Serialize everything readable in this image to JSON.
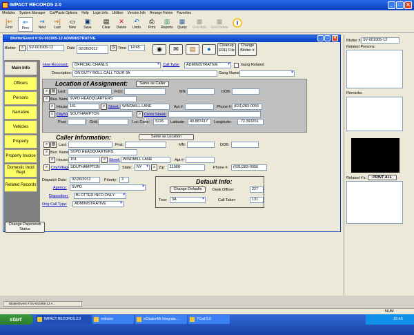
{
  "window": {
    "title": "IMPACT RECORDS 2.0"
  },
  "menu": [
    "Modules",
    "System Manager",
    "Cut/Paste Options",
    "Help",
    "Login Info",
    "Utilities",
    "Version Info",
    "Arrange Forms",
    "Favorites"
  ],
  "toolbar": [
    {
      "label": "First",
      "icon": "first-icon",
      "glyph": "|⇐"
    },
    {
      "label": "Prev",
      "icon": "prev-icon",
      "glyph": "⇐"
    },
    {
      "label": "Next",
      "icon": "next-icon",
      "glyph": "⇒"
    },
    {
      "label": "Last",
      "icon": "last-icon",
      "glyph": "⇒|"
    },
    {
      "label": "New",
      "icon": "new-icon",
      "glyph": "▭"
    },
    {
      "label": "Save",
      "icon": "save-icon",
      "glyph": "▣"
    },
    {
      "label": "Clear",
      "icon": "clear-icon",
      "glyph": "▤"
    },
    {
      "label": "Delete",
      "icon": "delete-icon",
      "glyph": "✕"
    },
    {
      "label": "Undo",
      "icon": "undo-icon",
      "glyph": "↶"
    },
    {
      "label": "Print",
      "icon": "print-icon",
      "glyph": "⎙"
    },
    {
      "label": "Reports",
      "icon": "reports-icon",
      "glyph": "▥"
    },
    {
      "label": "Query",
      "icon": "query-icon",
      "glyph": "▦"
    },
    {
      "label": "Grid Add",
      "icon": "grid-add-icon",
      "glyph": "▦"
    },
    {
      "label": "Grid Delete",
      "icon": "grid-delete-icon",
      "glyph": "▦"
    }
  ],
  "form": {
    "title": "Blotter/Event #:SV-001905-12 ADMINISTRATIVE",
    "blotter_label": "Blotter",
    "blotter_no": "SV-001905-12",
    "date_label": "Date",
    "date": "02/26/2012",
    "time_label": "Time",
    "time": "14:45",
    "cleanup_btn": "Cleanup E911 File",
    "change_blotter_btn": "Change Blotter #",
    "tabs": [
      "Main Info",
      "Officers",
      "Persons",
      "Narrative",
      "Vehicles",
      "Property",
      "Property Invoice",
      "Domestic Incid Rept",
      "Related Records"
    ],
    "change_paperwork_btn": "Change Paperwork Status",
    "how_received_label": "How Received:",
    "how_received": "OFFICIAL CHANLS",
    "call_type_label": "Call Type:",
    "call_type": "ADMINISTRATIVE",
    "gang_related_label": "Gang Related",
    "description_label": "Description:",
    "description": "ON DUTY ROLL CALL TOUR 3A",
    "gang_name_label": "Gang Name:",
    "loa_title": "Location of Assignment:",
    "same_as_caller_btn": "Same as Caller",
    "last_label": "Last:",
    "first_label": "First:",
    "mn_label": "MN:",
    "dob_label": "DOB:",
    "bus_name_label": "Bus. Name:",
    "loa_bus_name": "SVPD HEADQUARTERS",
    "house_label": "House:",
    "loa_house": "151",
    "street_label": "Street:",
    "loa_street": "WINDMILL LANE",
    "apt_label": "Apt #:",
    "phone_label": "Phone #:",
    "loa_phone": "(631)283-0056",
    "city_label": "City/Village",
    "loa_city": "SOUTHAMPTON",
    "cross_street_label": "Cross Street:",
    "post_label": "Post:",
    "grid_label": "Grid:",
    "loc_code_label": "Loc Code:",
    "loc_code": "5226",
    "latitude_label": "Latitude:",
    "latitude": "40.887417",
    "longitude_label": "Longitude:",
    "longitude": "-72.393261",
    "ci_title": "Caller Information:",
    "same_as_location_btn": "Same as Location",
    "ci_bus_name": "SVPD HEADQUARTERS",
    "ci_house": "151",
    "ci_street": "WINDMILL LANE",
    "ci_city": "SOUTHAMPTON",
    "state_label": "State:",
    "state": "NY",
    "zip_label": "Zip:",
    "zip": "11968-",
    "ci_phone": "(631)283-0056",
    "dispatch_date_label": "Dispatch Date:",
    "dispatch_date": "02/26/2012",
    "priority_label": "Priority:",
    "priority": "3",
    "agency_label": "Agency:",
    "agency": "SVPD",
    "disposition_label": "Disposition:",
    "disposition": "BLOTTER INFO ONLY",
    "orig_call_type_label": "Orig Call Type:",
    "orig_call_type": "ADMINISTRATIVE",
    "default_title": "Default Info:",
    "change_defaults_btn": "Change Defaults",
    "desk_officer_label": "Desk Officer:",
    "desk_officer": "227",
    "tour_label": "Tour:",
    "tour": "3A",
    "call_taker_label": "Call Taker:",
    "call_taker": "131"
  },
  "right": {
    "blotter_label": "Blotter #:",
    "blotter_no": "SV-001905-12",
    "related_persons_label": "Related Persons:",
    "remarks_label": "Remarks:",
    "related_label": "Related #'s:",
    "print_all_btn": "PRINT ALL"
  },
  "minimized": "Blotter/Event #:SV-001905-12 A...",
  "status": {
    "num": "NUM"
  },
  "taskbar": {
    "start": "start",
    "items": [
      "IMPACT RECORDS 2.0",
      "redmine",
      "eCitationMr Integrate...",
      "YCad 5.0"
    ],
    "clock": "15:45"
  }
}
